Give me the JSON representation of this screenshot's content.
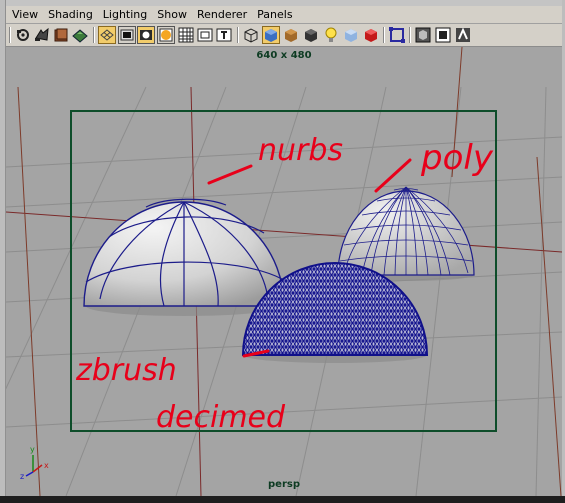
{
  "menubar": {
    "items": [
      {
        "label": "View"
      },
      {
        "label": "Shading"
      },
      {
        "label": "Lighting"
      },
      {
        "label": "Show"
      },
      {
        "label": "Renderer"
      },
      {
        "label": "Panels"
      }
    ]
  },
  "toolbar": {
    "icons": [
      "select-camera-icon",
      "camera-attributes-icon",
      "bookmark-icon",
      "image-plane-icon",
      "grid-icon",
      "film-gate-icon",
      "resolution-gate-icon",
      "gate-mask-icon",
      "field-chart-icon",
      "safe-action-icon",
      "safe-title-icon",
      "wireframe-icon",
      "smooth-shade-icon",
      "default-material-icon",
      "shadows-icon",
      "use-lights-icon",
      "textured-icon",
      "hardware-texturing-icon",
      "isolate-select-icon",
      "xray-icon",
      "frame-all-icon",
      "frame-selection-icon",
      "render-view-icon"
    ]
  },
  "viewport": {
    "resolution_label": "640 x 480",
    "camera_label": "persp",
    "axis_x": "x",
    "axis_y": "y",
    "axis_z": "z",
    "colors": {
      "gate": "#0e4d2a",
      "wire": "#1c1c8a",
      "annotation": "#e8001a"
    }
  },
  "annotations": {
    "nurbs": "nurbs",
    "poly": "poly",
    "zbrush": "zbrush",
    "decimed": "decimed"
  }
}
